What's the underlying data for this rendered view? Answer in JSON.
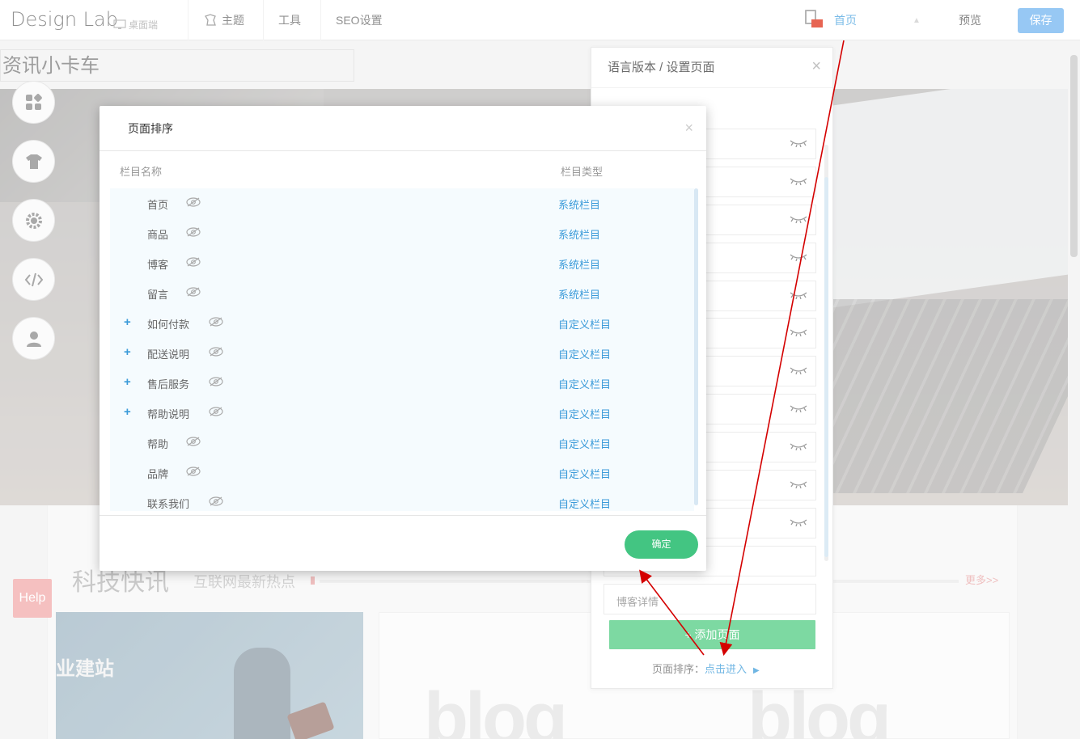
{
  "topbar": {
    "brand": "Design Lab",
    "device_label": "桌面端",
    "nav": [
      {
        "label": "主题"
      },
      {
        "label": "工具"
      },
      {
        "label": "SEO设置"
      }
    ],
    "current_page": "首页",
    "preview_label": "预览",
    "save_label": "保存"
  },
  "site": {
    "title": "资讯小卡车",
    "section_title": "科技快讯",
    "section_subtitle": "互联网最新热点",
    "more_link": "更多>>",
    "help_label": "Help",
    "card_text": "业建站",
    "blog_word": "blog"
  },
  "lang_panel": {
    "title": "语言版本 / 设置页面",
    "close_glyph": "×",
    "last_row_text": "博客详情",
    "add_page_label": "+ 添加页面",
    "sort_prefix": "页面排序：",
    "sort_link": "点击进入"
  },
  "modal": {
    "title": "页面排序",
    "close_glyph": "×",
    "col_name": "栏目名称",
    "col_type": "栏目类型",
    "rows": [
      {
        "name": "首页",
        "type": "系统栏目",
        "expandable": false
      },
      {
        "name": "商品",
        "type": "系统栏目",
        "expandable": false
      },
      {
        "name": "博客",
        "type": "系统栏目",
        "expandable": false
      },
      {
        "name": "留言",
        "type": "系统栏目",
        "expandable": false
      },
      {
        "name": "如何付款",
        "type": "自定义栏目",
        "expandable": true
      },
      {
        "name": "配送说明",
        "type": "自定义栏目",
        "expandable": true
      },
      {
        "name": "售后服务",
        "type": "自定义栏目",
        "expandable": true
      },
      {
        "name": "帮助说明",
        "type": "自定义栏目",
        "expandable": true
      },
      {
        "name": "帮助",
        "type": "自定义栏目",
        "expandable": false
      },
      {
        "name": "品牌",
        "type": "自定义栏目",
        "expandable": false
      },
      {
        "name": "联系我们",
        "type": "自定义栏目",
        "expandable": false
      }
    ],
    "confirm_label": "确定"
  },
  "colors": {
    "accent_blue": "#3a9ad9",
    "save_blue": "#6fb3f0",
    "green": "#43c582",
    "annotation_red": "#d40000"
  }
}
